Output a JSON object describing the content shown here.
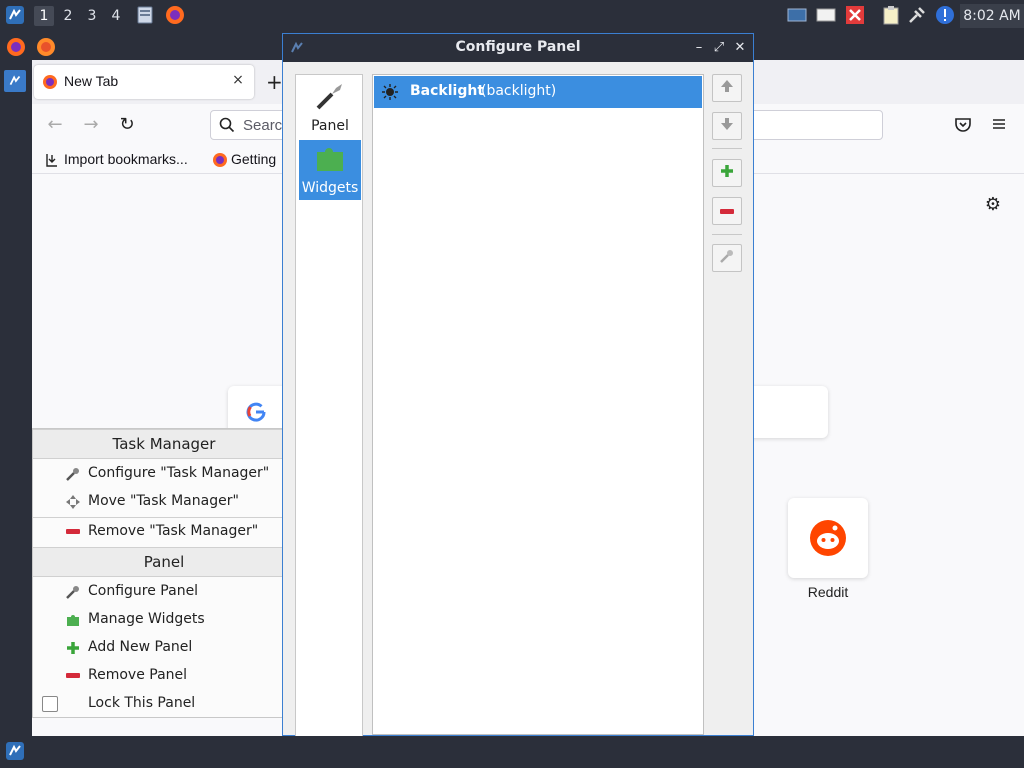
{
  "top_panel": {
    "desktops": [
      "1",
      "2",
      "3",
      "4"
    ],
    "active_desktop": "1",
    "clock": "8:02 AM",
    "tray_icons": [
      "display-icon",
      "drive-icon",
      "close-red-icon",
      "clipboard-icon",
      "network-icon",
      "alert-icon"
    ]
  },
  "firefox": {
    "tab_title": "New Tab",
    "tab_close": "×",
    "new_tab": "+",
    "url_placeholder": "Search",
    "bookmarks": [
      "Import bookmarks...",
      "Getting"
    ],
    "tile_label": "Reddit"
  },
  "context_menu": {
    "section1_title": "Task Manager",
    "section1_items": [
      "Configure \"Task Manager\"",
      "Move \"Task Manager\"",
      "Remove \"Task Manager\""
    ],
    "section2_title": "Panel",
    "section2_items": [
      "Configure Panel",
      "Manage Widgets",
      "Add New Panel",
      "Remove Panel",
      "Lock This Panel"
    ]
  },
  "dialog": {
    "title": "Configure Panel",
    "sidebar": [
      {
        "label": "Panel",
        "icon": "wrench-icon"
      },
      {
        "label": "Widgets",
        "icon": "puzzle-icon"
      }
    ],
    "selected_sidebar": "Widgets",
    "widgets": [
      {
        "name": "Backlight",
        "id": "(backlight)"
      }
    ]
  },
  "colors": {
    "panel_bg": "#2b2f3a",
    "selection": "#3b8ee0",
    "accent_border": "#3b7fd1"
  }
}
